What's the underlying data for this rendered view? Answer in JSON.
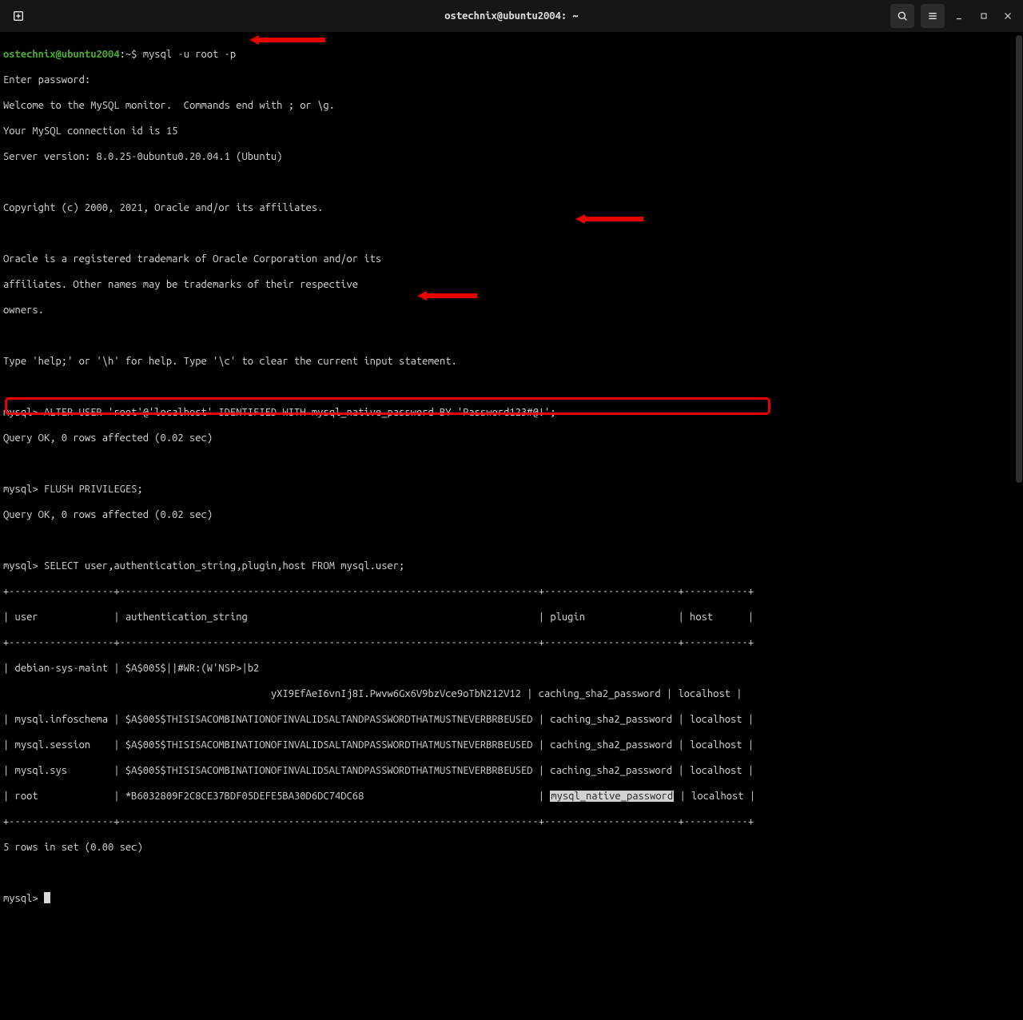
{
  "window": {
    "title": "ostechnix@ubuntu2004: ~"
  },
  "prompt": {
    "user_host": "ostechnix@ubuntu2004",
    "sep": ":",
    "path": "~",
    "sigil": "$",
    "command": "mysql -u root -p"
  },
  "intro": {
    "enter_pw": "Enter password:",
    "welcome": "Welcome to the MySQL monitor.  Commands end with ; or \\g.",
    "conn_id": "Your MySQL connection id is 15",
    "server": "Server version: 8.0.25-0ubuntu0.20.04.1 (Ubuntu)",
    "copyright": "Copyright (c) 2000, 2021, Oracle and/or its affiliates.",
    "tm1": "Oracle is a registered trademark of Oracle Corporation and/or its",
    "tm2": "affiliates. Other names may be trademarks of their respective",
    "tm3": "owners.",
    "help": "Type 'help;' or '\\h' for help. Type '\\c' to clear the current input statement."
  },
  "sql": {
    "prompt": "mysql>",
    "alter": " ALTER USER 'root'@'localhost' IDENTIFIED WITH mysql_native_password BY 'Password123#@!';",
    "ok1": "Query OK, 0 rows affected (0.02 sec)",
    "flush": " FLUSH PRIVILEGES;",
    "ok2": "Query OK, 0 rows affected (0.02 sec)",
    "select": " SELECT user,authentication_string,plugin,host FROM mysql.user;"
  },
  "table": {
    "border": "+------------------+------------------------------------------------------------------------+-----------------------+-----------+",
    "header": "| user             | authentication_string                                                  | plugin                | host      |",
    "row_deb1": "| debian-sys-maint | $A$005$||#WR:(W'NSP>|b2",
    "row_deb2": "                                              yXI9EfAeI6vnIj8I.Pwvw6Gx6V9bzVce9oTbN212V12 | caching_sha2_password | localhost |",
    "row_info": "| mysql.infoschema | $A$005$THISISACOMBINATIONOFINVALIDSALTANDPASSWORDTHATMUSTNEVERBRBEUSED | caching_sha2_password | localhost |",
    "row_sess": "| mysql.session    | $A$005$THISISACOMBINATIONOFINVALIDSALTANDPASSWORDTHATMUSTNEVERBRBEUSED | caching_sha2_password | localhost |",
    "row_sys": "| mysql.sys        | $A$005$THISISACOMBINATIONOFINVALIDSALTANDPASSWORDTHATMUSTNEVERBRBEUSED | caching_sha2_password | localhost |",
    "row_root_a": "| root             | *B6032809F2C8CE37BDF05DEFE5BA30D6DC74DC68                              | ",
    "row_root_plugin": "mysql_native_password",
    "row_root_b": " | localhost |",
    "summary": "5 rows in set (0.00 sec)"
  },
  "final_prompt": "mysql> "
}
